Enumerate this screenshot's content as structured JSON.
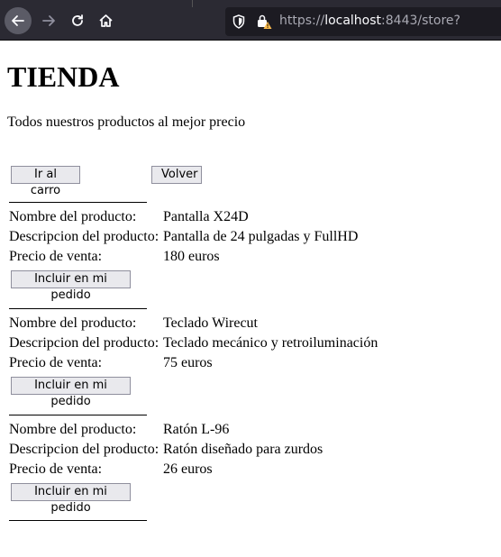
{
  "browser": {
    "url_scheme": "https://",
    "url_host": "localhost",
    "url_rest": ":8443/store?"
  },
  "page": {
    "title": "TIENDA",
    "subtitle": "Todos nuestros productos al mejor precio",
    "cart_button": "Ir al carro",
    "back_button": "Volver"
  },
  "labels": {
    "name": "Nombre del producto:",
    "description": "Descripcion del producto:",
    "price": "Precio de venta:",
    "add_button": "Incluir en mi pedido"
  },
  "products": [
    {
      "name": "Pantalla X24D",
      "description": "Pantalla de 24 pulgadas y FullHD",
      "price": "180 euros"
    },
    {
      "name": "Teclado Wirecut",
      "description": "Teclado mecánico y retroiluminación",
      "price": "75 euros"
    },
    {
      "name": "Ratón L-96",
      "description": "Ratón diseñado para zurdos",
      "price": "26 euros"
    }
  ]
}
